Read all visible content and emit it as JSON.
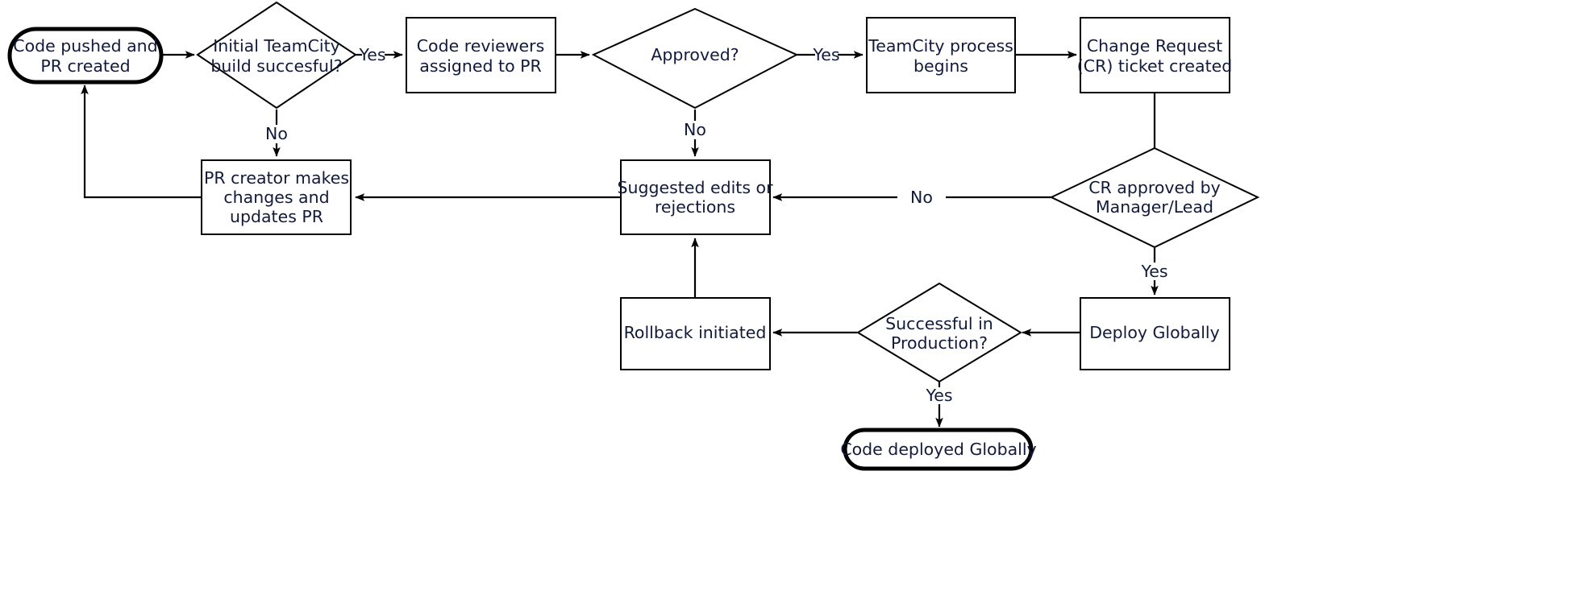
{
  "diagram": {
    "type": "flowchart",
    "title": "Code deployment process flowchart",
    "orientation": "left-to-right with loop-backs",
    "colors": {
      "background": "#ffffff",
      "node_stroke": "#000000",
      "node_fill": "#ffffff",
      "text": "#111a3d",
      "edge": "#000000"
    }
  },
  "nodes": [
    {
      "id": "start",
      "shape": "stadium",
      "label": "Code pushed and PR created",
      "lines": [
        "Code pushed and",
        "PR created"
      ]
    },
    {
      "id": "build_check",
      "shape": "diamond",
      "label": "Initial TeamCity build succesful?",
      "lines": [
        "Initial TeamCity",
        "build succesful?"
      ]
    },
    {
      "id": "reviewers",
      "shape": "rect",
      "label": "Code reviewers assigned to PR",
      "lines": [
        "Code reviewers",
        "assigned to PR"
      ]
    },
    {
      "id": "approved",
      "shape": "diamond",
      "label": "Approved?",
      "lines": [
        "Approved?"
      ]
    },
    {
      "id": "teamcity_process",
      "shape": "rect",
      "label": "TeamCity process begins",
      "lines": [
        "TeamCity process",
        "begins"
      ]
    },
    {
      "id": "cr_ticket",
      "shape": "rect",
      "label": "Change Request (CR) ticket created",
      "lines": [
        "Change Request",
        "(CR) ticket created"
      ]
    },
    {
      "id": "pr_creator",
      "shape": "rect",
      "label": "PR creator makes changes and updates PR",
      "lines": [
        "PR creator makes",
        "changes and",
        "updates PR"
      ]
    },
    {
      "id": "suggested_edits",
      "shape": "rect",
      "label": "Suggested edits or rejections",
      "lines": [
        "Suggested edits or",
        "rejections"
      ]
    },
    {
      "id": "cr_approved",
      "shape": "diamond",
      "label": "CR approved by Manager/Lead",
      "lines": [
        "CR approved by",
        "Manager/Lead"
      ]
    },
    {
      "id": "rollback",
      "shape": "rect",
      "label": "Rollback initiated",
      "lines": [
        "Rollback initiated"
      ]
    },
    {
      "id": "prod_check",
      "shape": "diamond",
      "label": "Successful in Production?",
      "lines": [
        "Successful in",
        "Production?"
      ]
    },
    {
      "id": "deploy",
      "shape": "rect",
      "label": "Deploy Globally",
      "lines": [
        "Deploy Globally"
      ]
    },
    {
      "id": "end",
      "shape": "stadium",
      "label": "Code deployed Globally",
      "lines": [
        "Code deployed Globally"
      ]
    }
  ],
  "edges": [
    {
      "from": "start",
      "to": "build_check",
      "label": ""
    },
    {
      "from": "build_check",
      "to": "reviewers",
      "label": "Yes"
    },
    {
      "from": "build_check",
      "to": "pr_creator",
      "label": "No"
    },
    {
      "from": "reviewers",
      "to": "approved",
      "label": ""
    },
    {
      "from": "approved",
      "to": "teamcity_process",
      "label": "Yes"
    },
    {
      "from": "approved",
      "to": "suggested_edits",
      "label": "No"
    },
    {
      "from": "teamcity_process",
      "to": "cr_ticket",
      "label": ""
    },
    {
      "from": "cr_ticket",
      "to": "cr_approved",
      "label": ""
    },
    {
      "from": "cr_approved",
      "to": "suggested_edits",
      "label": "No"
    },
    {
      "from": "cr_approved",
      "to": "deploy",
      "label": "Yes"
    },
    {
      "from": "suggested_edits",
      "to": "pr_creator",
      "label": ""
    },
    {
      "from": "pr_creator",
      "to": "start",
      "label": ""
    },
    {
      "from": "deploy",
      "to": "prod_check",
      "label": ""
    },
    {
      "from": "prod_check",
      "to": "rollback",
      "label": ""
    },
    {
      "from": "prod_check",
      "to": "end",
      "label": "Yes"
    },
    {
      "from": "rollback",
      "to": "suggested_edits",
      "label": ""
    }
  ],
  "edge_labels": {
    "build_yes": "Yes",
    "build_no": "No",
    "approved_yes": "Yes",
    "approved_no": "No",
    "cr_no": "No",
    "cr_yes": "Yes",
    "prod_yes": "Yes"
  },
  "node_text": {
    "start": {
      "l1": "Code pushed and",
      "l2": "PR created"
    },
    "build_check": {
      "l1": "Initial TeamCity",
      "l2": "build succesful?"
    },
    "reviewers": {
      "l1": "Code reviewers",
      "l2": "assigned to PR"
    },
    "approved": {
      "l1": "Approved?"
    },
    "teamcity_process": {
      "l1": "TeamCity process",
      "l2": "begins"
    },
    "cr_ticket": {
      "l1": "Change Request",
      "l2": "(CR) ticket created"
    },
    "pr_creator": {
      "l1": "PR creator makes",
      "l2": "changes and",
      "l3": "updates PR"
    },
    "suggested_edits": {
      "l1": "Suggested edits or",
      "l2": "rejections"
    },
    "cr_approved": {
      "l1": "CR approved by",
      "l2": "Manager/Lead"
    },
    "rollback": {
      "l1": "Rollback initiated"
    },
    "prod_check": {
      "l1": "Successful in",
      "l2": "Production?"
    },
    "deploy": {
      "l1": "Deploy Globally"
    },
    "end": {
      "l1": "Code deployed Globally"
    }
  }
}
